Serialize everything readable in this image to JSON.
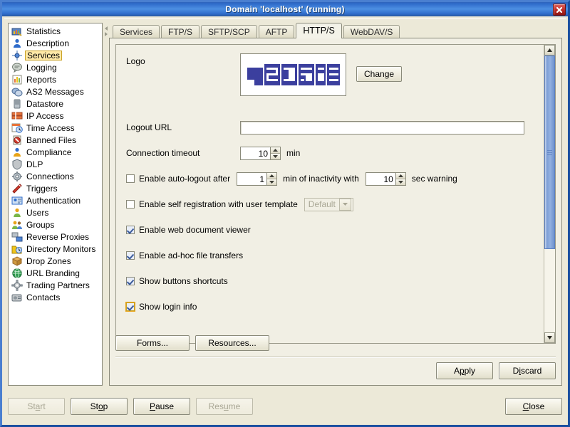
{
  "window": {
    "title": "Domain 'localhost' (running)",
    "close_icon": "close-icon"
  },
  "sidebar": {
    "items": [
      {
        "label": "Statistics",
        "icon": "statistics-icon"
      },
      {
        "label": "Description",
        "icon": "description-icon"
      },
      {
        "label": "Services",
        "icon": "services-icon",
        "selected": true
      },
      {
        "label": "Logging",
        "icon": "logging-icon"
      },
      {
        "label": "Reports",
        "icon": "reports-icon"
      },
      {
        "label": "AS2 Messages",
        "icon": "as2-messages-icon"
      },
      {
        "label": "Datastore",
        "icon": "datastore-icon"
      },
      {
        "label": "IP Access",
        "icon": "ip-access-icon"
      },
      {
        "label": "Time Access",
        "icon": "time-access-icon"
      },
      {
        "label": "Banned Files",
        "icon": "banned-files-icon"
      },
      {
        "label": "Compliance",
        "icon": "compliance-icon"
      },
      {
        "label": "DLP",
        "icon": "dlp-icon"
      },
      {
        "label": "Connections",
        "icon": "connections-icon"
      },
      {
        "label": "Triggers",
        "icon": "triggers-icon"
      },
      {
        "label": "Authentication",
        "icon": "authentication-icon"
      },
      {
        "label": "Users",
        "icon": "users-icon"
      },
      {
        "label": "Groups",
        "icon": "groups-icon"
      },
      {
        "label": "Reverse Proxies",
        "icon": "reverse-proxies-icon"
      },
      {
        "label": "Directory Monitors",
        "icon": "directory-monitors-icon"
      },
      {
        "label": "Drop Zones",
        "icon": "drop-zones-icon"
      },
      {
        "label": "URL Branding",
        "icon": "url-branding-icon"
      },
      {
        "label": "Trading Partners",
        "icon": "trading-partners-icon"
      },
      {
        "label": "Contacts",
        "icon": "contacts-icon"
      }
    ]
  },
  "tabs": [
    {
      "label": "Services",
      "active": false
    },
    {
      "label": "FTP/S",
      "active": false
    },
    {
      "label": "SFTP/SCP",
      "active": false
    },
    {
      "label": "AFTP",
      "active": false
    },
    {
      "label": "HTTP/S",
      "active": true
    },
    {
      "label": "WebDAV/S",
      "active": false
    }
  ],
  "form": {
    "logo_label": "Logo",
    "logo_alt": "jscape",
    "change_button": "Change",
    "logout_url_label": "Logout URL",
    "logout_url_value": "",
    "connection_timeout_label": "Connection timeout",
    "connection_timeout_value": "10",
    "connection_timeout_unit": "min",
    "auto_logout_label": "Enable auto-logout after",
    "auto_logout_checked": false,
    "auto_logout_minutes": "1",
    "auto_logout_mid_text": "min of inactivity with",
    "auto_logout_seconds": "10",
    "auto_logout_tail_text": "sec warning",
    "self_registration_label": "Enable self registration with user template",
    "self_registration_checked": false,
    "self_registration_template": "Default",
    "web_doc_viewer_label": "Enable web document viewer",
    "web_doc_viewer_checked": true,
    "adhoc_transfers_label": "Enable ad-hoc file transfers",
    "adhoc_transfers_checked": true,
    "buttons_shortcuts_label": "Show buttons shortcuts",
    "buttons_shortcuts_checked": true,
    "login_info_label": "Show login info",
    "login_info_checked": true
  },
  "panel_buttons": {
    "forms": "Forms...",
    "resources": "Resources...",
    "apply": "Apply",
    "apply_mnemonic": "p",
    "discard": "Discard",
    "discard_mnemonic": "i"
  },
  "statusbar": {
    "start": "Start",
    "start_mnemonic": "a",
    "start_enabled": false,
    "stop": "Stop",
    "stop_mnemonic": "o",
    "stop_enabled": true,
    "pause": "Pause",
    "pause_mnemonic": "P",
    "pause_enabled": true,
    "resume": "Resume",
    "resume_mnemonic": "u",
    "resume_enabled": false,
    "close": "Close",
    "close_mnemonic": "C"
  },
  "colors": {
    "titlebar": "#2f6ccb",
    "panel": "#ece9d8",
    "tab_panel": "#f1efe4",
    "selection_highlight": "#ffe9a8",
    "selection_border": "#c9a227",
    "logo_blue": "#3b3f9e",
    "scrollbar_thumb": "#7e9fd6",
    "close_button": "#c4302b",
    "focus_outline": "#e8a317"
  },
  "scrollbar": {
    "up_icon": "scroll-up-icon",
    "down_icon": "scroll-down-icon",
    "thumb_position_percent": 0
  }
}
